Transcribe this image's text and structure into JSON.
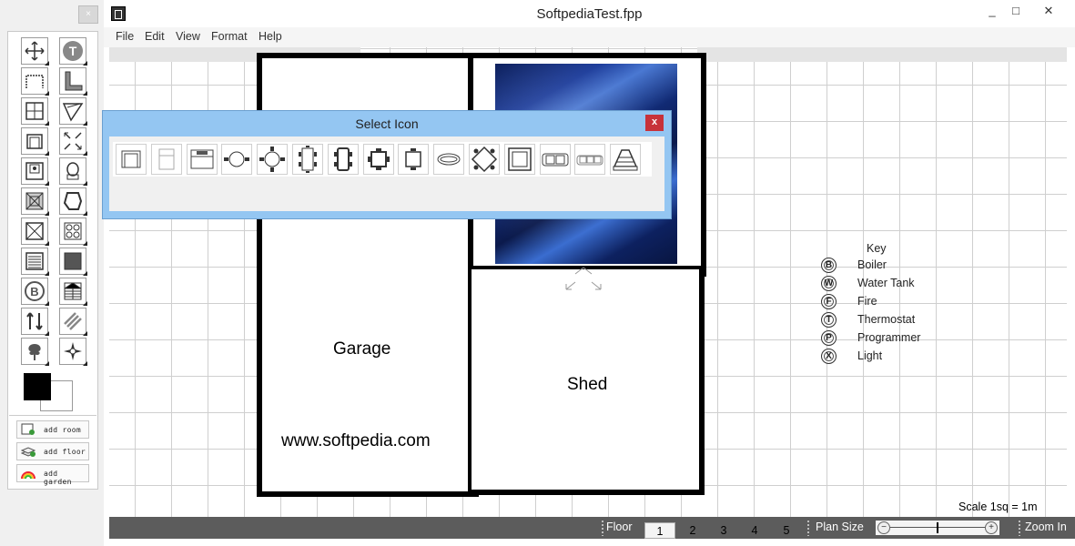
{
  "toolbox": {
    "close_label": "×",
    "tools": [
      {
        "name": "move-tool-icon"
      },
      {
        "name": "text-tool-icon",
        "label": "T"
      },
      {
        "name": "door-tool-icon"
      },
      {
        "name": "wall-corner-tool-icon"
      },
      {
        "name": "window-tool-icon"
      },
      {
        "name": "stair-tool-icon"
      },
      {
        "name": "armchair-tool-icon"
      },
      {
        "name": "resize-tool-icon"
      },
      {
        "name": "stove-tool-icon"
      },
      {
        "name": "toilet-tool-icon"
      },
      {
        "name": "cross-panel-tool-icon"
      },
      {
        "name": "bath-tool-icon"
      },
      {
        "name": "crossed-box-tool-icon"
      },
      {
        "name": "hob-tool-icon"
      },
      {
        "name": "radiator-tool-icon"
      },
      {
        "name": "filled-square-tool-icon"
      },
      {
        "name": "boiler-key-tool-icon",
        "label": "B"
      },
      {
        "name": "staircase-tool-icon"
      },
      {
        "name": "arrows-tool-icon"
      },
      {
        "name": "hatch-tool-icon"
      },
      {
        "name": "tree-tool-icon"
      },
      {
        "name": "compass-tool-icon"
      }
    ],
    "add_buttons": [
      {
        "name": "add-room-button",
        "label": "add room"
      },
      {
        "name": "add-floor-button",
        "label": "add floor"
      },
      {
        "name": "add-garden-button",
        "label": "add garden"
      }
    ]
  },
  "window": {
    "title": "SoftpediaTest.fpp",
    "minimize": "_",
    "maximize": "□",
    "close": "✕"
  },
  "menu": [
    "File",
    "Edit",
    "View",
    "Format",
    "Help"
  ],
  "plan": {
    "rooms": [
      "Garage",
      "Shed"
    ],
    "watermark": "www.softpedia.com",
    "scale": "Scale 1sq = 1m"
  },
  "key": {
    "title": "Key",
    "items": [
      {
        "symbol": "B",
        "label": "Boiler"
      },
      {
        "symbol": "W",
        "label": "Water Tank"
      },
      {
        "symbol": "F",
        "label": "Fire"
      },
      {
        "symbol": "T",
        "label": "Thermostat"
      },
      {
        "symbol": "P",
        "label": "Programmer"
      },
      {
        "symbol": "X",
        "label": "Light"
      }
    ]
  },
  "status": {
    "floor_label": "Floor",
    "floors": [
      "1",
      "2",
      "3",
      "4",
      "5"
    ],
    "active_floor": "1",
    "plan_size_label": "Plan Size",
    "zoom_label": "Zoom In",
    "zoom_minus": "−",
    "zoom_plus": "+",
    "zoom_level": 0.5
  },
  "dialog": {
    "title": "Select Icon",
    "close": "x",
    "icons": [
      "armchair-icon",
      "fridge-icon",
      "bed-icon",
      "round-table-2-icon",
      "round-table-4-icon",
      "rect-table-6-icon",
      "rect-table-8-icon",
      "square-table-4-icon",
      "square-table-2-icon",
      "sink-icon",
      "diamond-table-icon",
      "square-rug-icon",
      "sofa-2-icon",
      "sofa-3-icon",
      "lamp-icon"
    ]
  }
}
